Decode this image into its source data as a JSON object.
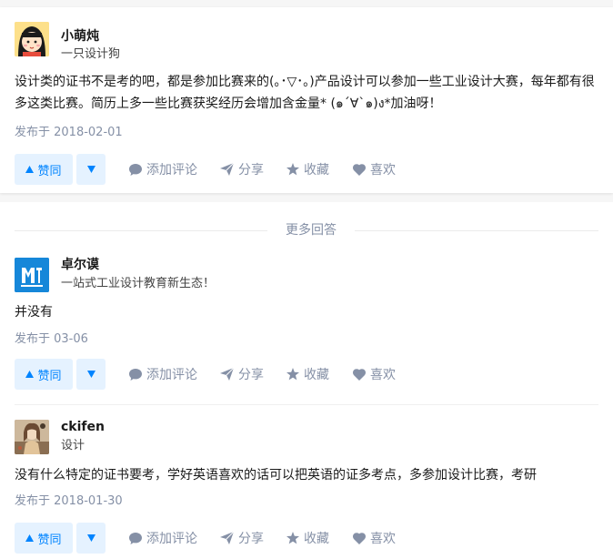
{
  "colors": {
    "accent": "#0084ff",
    "vote_bg": "#e5f2ff",
    "muted": "#8590a6"
  },
  "actions": {
    "upvote_label": "赞同",
    "comment_label": "添加评论",
    "share_label": "分享",
    "collect_label": "收藏",
    "like_label": "喜欢"
  },
  "more_answers_label": "更多回答",
  "answers": [
    {
      "author": "小萌炖",
      "bio": "一只设计狗",
      "content": "设计类的证书不是考的吧，都是参加比赛来的(｡･▽･｡)产品设计可以参加一些工业设计大赛，每年都有很多这类比赛。简历上多一些比赛获奖经历会增加含金量* (๑´∀`๑)ง*加油呀！",
      "date": "发布于 2018-02-01",
      "avatar_icon": "cartoon-girl-avatar"
    },
    {
      "author": "卓尔谟",
      "bio": "一站式工业设计教育新生态！",
      "content": "并没有",
      "date": "发布于 03-06",
      "avatar_icon": "brand-logo-avatar"
    },
    {
      "author": "ckifen",
      "bio": "设计",
      "content": "没有什么特定的证书要考，学好英语喜欢的话可以把英语的证多考点，多参加设计比赛，考研",
      "date": "发布于 2018-01-30",
      "avatar_icon": "illustration-avatar"
    }
  ]
}
